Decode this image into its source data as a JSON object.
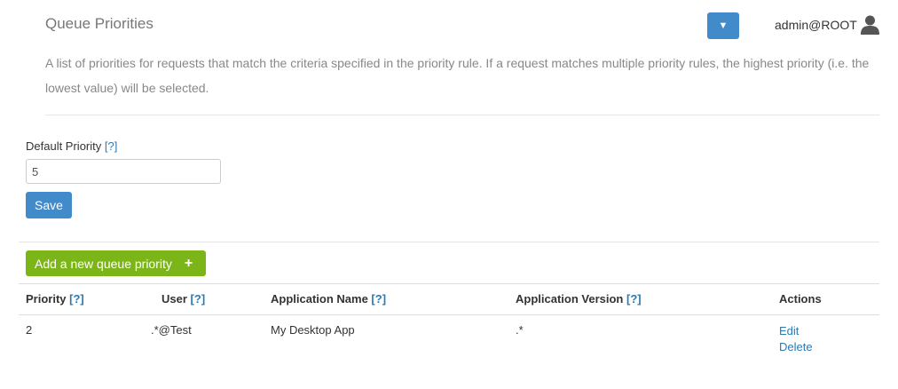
{
  "header": {
    "title": "Queue Priorities",
    "menu_icon": "▼",
    "user_label": "admin@ROOT"
  },
  "description": "A list of priorities for requests that match the criteria specified in the priority rule. If a request matches multiple priority rules, the highest priority (i.e. the lowest value) will be selected.",
  "default_priority": {
    "label": "Default Priority",
    "help": "[?]",
    "value": "5",
    "save_label": "Save"
  },
  "add_button": {
    "label": "Add a new queue priority",
    "icon": "+"
  },
  "table": {
    "headers": [
      {
        "label": "Priority",
        "help": "[?]"
      },
      {
        "label": "User",
        "help": "[?]"
      },
      {
        "label": "Application Name",
        "help": "[?]"
      },
      {
        "label": "Application Version",
        "help": "[?]"
      },
      {
        "label": "Actions",
        "help": ""
      }
    ],
    "rows": [
      {
        "priority": "2",
        "user": ".*@Test",
        "application_name": "My Desktop App",
        "application_version": ".*",
        "actions": [
          "Edit",
          "Delete"
        ]
      }
    ]
  },
  "colors": {
    "primary": "#428bca",
    "success": "#7cb518",
    "link": "#2a7ab0"
  }
}
